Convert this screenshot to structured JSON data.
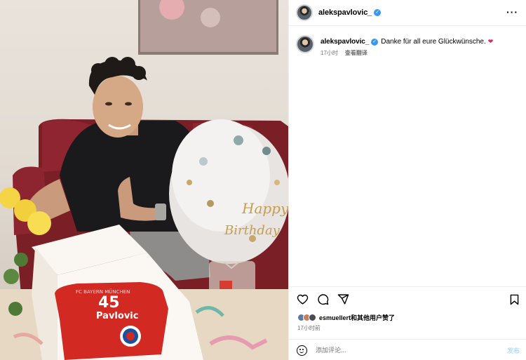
{
  "header": {
    "username": "alekspavlovic_",
    "verified_symbol": "✓",
    "more_symbol": "···"
  },
  "caption": {
    "username": "alekspavlovic_",
    "text": "Danke für all eure Glückwünsche.",
    "heart": "❤",
    "time": "17小时",
    "translate": "查看翻译"
  },
  "photo": {
    "jersey_club": "FC BAYERN MÜNCHEN",
    "jersey_number": "45",
    "jersey_name": "Pavlovic",
    "balloon_line1": "Happy",
    "balloon_line2": "Birthday"
  },
  "engagement": {
    "likes_text": "esmuellert和其他用户赞了",
    "time": "17小时前"
  },
  "comment": {
    "placeholder": "添加评论...",
    "post_label": "发布"
  },
  "colors": {
    "verified": "#3897f0",
    "heart": "#e0245e",
    "post_disabled": "#b2dffc",
    "meta_gray": "#737373"
  },
  "icons": [
    "ellipsis-icon",
    "heart-icon",
    "comment-icon",
    "share-icon",
    "bookmark-icon",
    "emoji-icon"
  ]
}
